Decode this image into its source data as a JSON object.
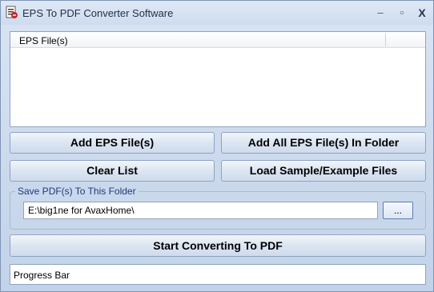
{
  "window": {
    "title": "EPS To PDF Converter Software",
    "minimize_glyph": "–",
    "maximize_glyph": "▫",
    "close_glyph": "X",
    "app_icon": "document-pdf-icon"
  },
  "file_list": {
    "column_header": "EPS File(s)",
    "rows": []
  },
  "buttons": {
    "add_files": "Add EPS File(s)",
    "add_folder": "Add All EPS File(s) In Folder",
    "clear_list": "Clear List",
    "load_sample": "Load Sample/Example Files",
    "start": "Start Converting To PDF"
  },
  "output": {
    "group_label": "Save PDF(s) To This Folder",
    "folder_path": "E:\\big1ne for AvaxHome\\",
    "browse_label": "..."
  },
  "progress": {
    "label": "Progress Bar",
    "value": 0
  }
}
